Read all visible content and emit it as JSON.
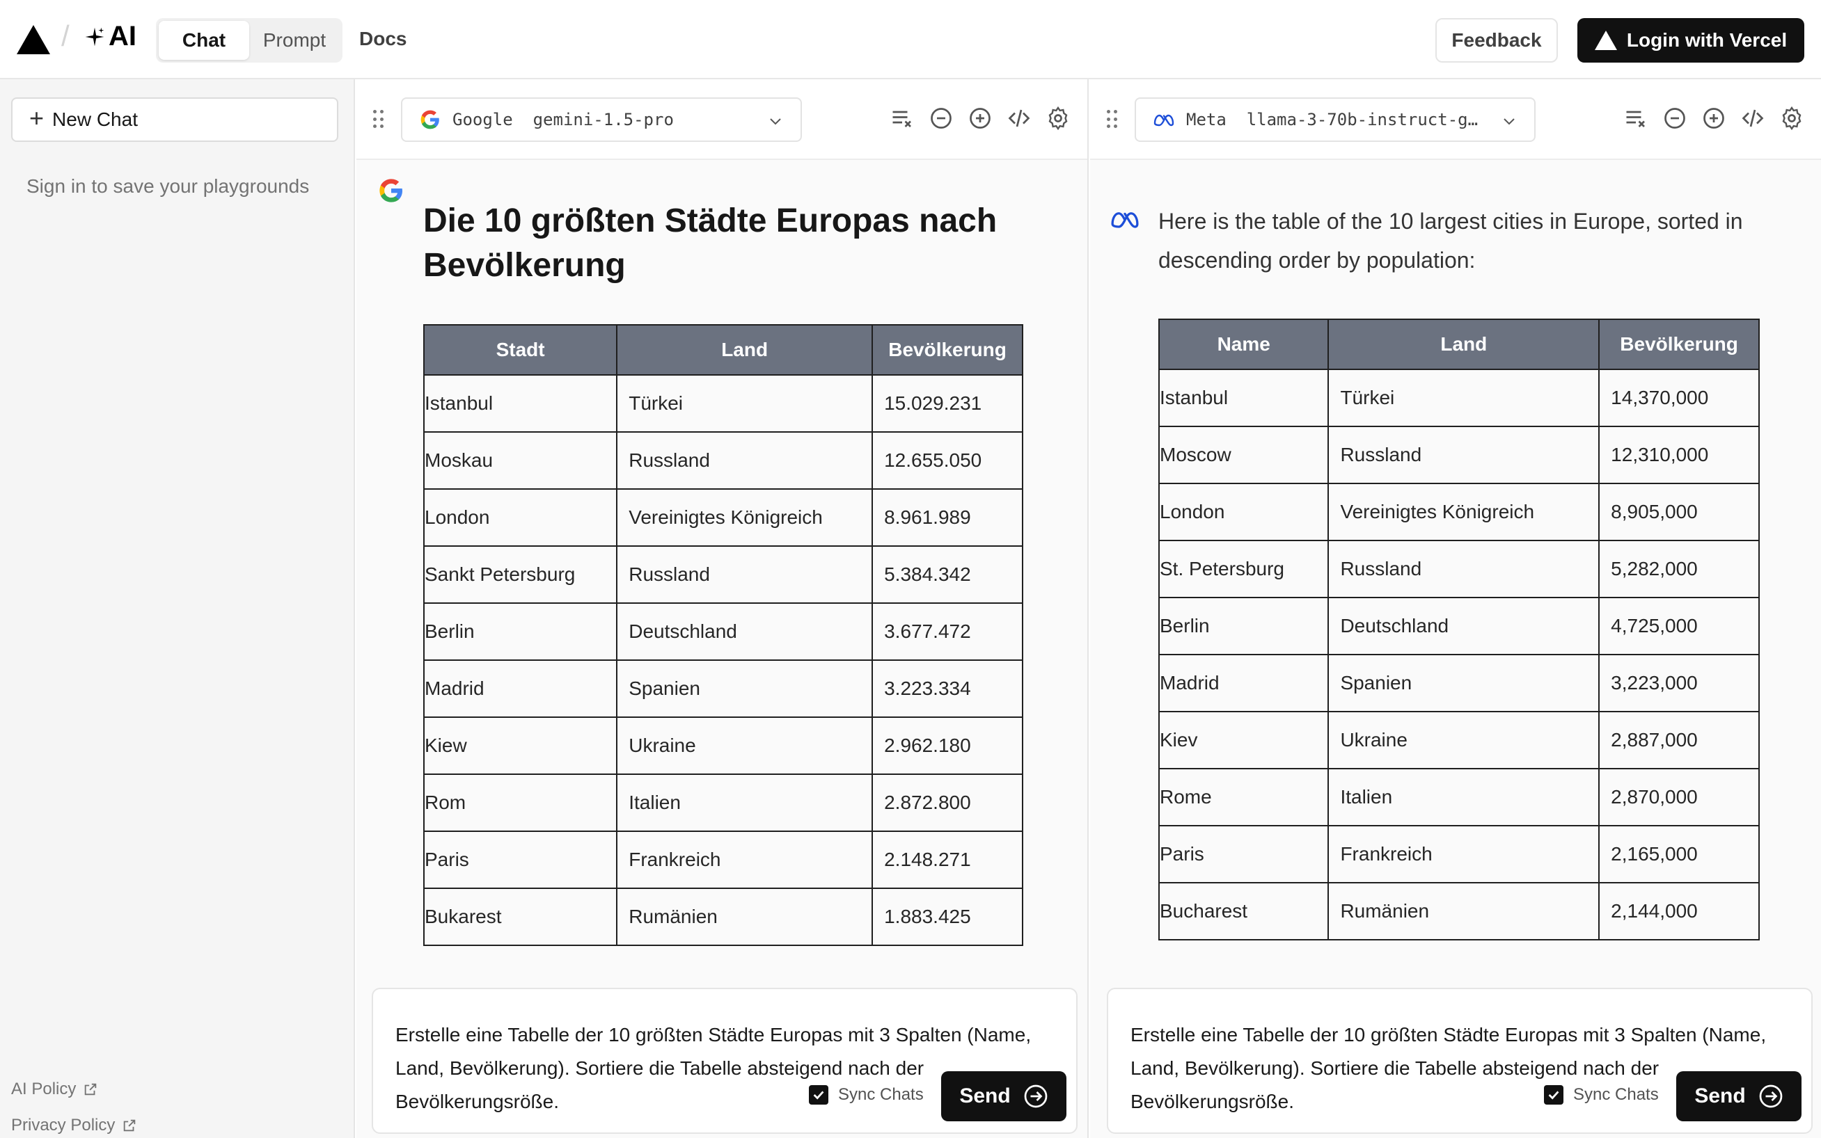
{
  "header": {
    "logo_text": "AI",
    "tabs": [
      {
        "label": "Chat",
        "active": true
      },
      {
        "label": "Prompt",
        "active": false
      }
    ],
    "docs_label": "Docs",
    "feedback_label": "Feedback",
    "login_label": "Login with Vercel"
  },
  "sidebar": {
    "new_chat_label": "New Chat",
    "signin_note": "Sign in to save your playgrounds",
    "footer_links": [
      "AI Policy",
      "Privacy Policy"
    ]
  },
  "colors": {
    "table_header_bg": "#6b7280",
    "button_bg": "#111111",
    "sidebar_bg": "#f5f5f5"
  },
  "panels": [
    {
      "provider": "Google",
      "model": "gemini-1.5-pro",
      "provider_icon": "google-icon",
      "message_heading": "Die 10 größten Städte Europas nach Bevölkerung",
      "table": {
        "headers": [
          "Stadt",
          "Land",
          "Bevölkerung"
        ],
        "rows": [
          [
            "Istanbul",
            "Türkei",
            "15.029.231"
          ],
          [
            "Moskau",
            "Russland",
            "12.655.050"
          ],
          [
            "London",
            "Vereinigtes Königreich",
            "8.961.989"
          ],
          [
            "Sankt Petersburg",
            "Russland",
            "5.384.342"
          ],
          [
            "Berlin",
            "Deutschland",
            "3.677.472"
          ],
          [
            "Madrid",
            "Spanien",
            "3.223.334"
          ],
          [
            "Kiew",
            "Ukraine",
            "2.962.180"
          ],
          [
            "Rom",
            "Italien",
            "2.872.800"
          ],
          [
            "Paris",
            "Frankreich",
            "2.148.271"
          ],
          [
            "Bukarest",
            "Rumänien",
            "1.883.425"
          ]
        ]
      },
      "prompt": "Erstelle eine Tabelle der 10 größten Städte Europas mit 3 Spalten (Name, Land, Bevölkerung). Sortiere die Tabelle absteigend nach der Bevölkerungsröße.",
      "sync_label": "Sync Chats",
      "send_label": "Send"
    },
    {
      "provider": "Meta",
      "model": "llama-3-70b-instruct-g…",
      "provider_icon": "meta-icon",
      "message_text": "Here is the table of the 10 largest cities in Europe, sorted in descending order by population:",
      "table": {
        "headers": [
          "Name",
          "Land",
          "Bevölkerung"
        ],
        "rows": [
          [
            "Istanbul",
            "Türkei",
            "14,370,000"
          ],
          [
            "Moscow",
            "Russland",
            "12,310,000"
          ],
          [
            "London",
            "Vereinigtes Königreich",
            "8,905,000"
          ],
          [
            "St. Petersburg",
            "Russland",
            "5,282,000"
          ],
          [
            "Berlin",
            "Deutschland",
            "4,725,000"
          ],
          [
            "Madrid",
            "Spanien",
            "3,223,000"
          ],
          [
            "Kiev",
            "Ukraine",
            "2,887,000"
          ],
          [
            "Rome",
            "Italien",
            "2,870,000"
          ],
          [
            "Paris",
            "Frankreich",
            "2,165,000"
          ],
          [
            "Bucharest",
            "Rumänien",
            "2,144,000"
          ]
        ]
      },
      "prompt": "Erstelle eine Tabelle der 10 größten Städte Europas mit 3 Spalten (Name, Land, Bevölkerung). Sortiere die Tabelle absteigend nach der Bevölkerungsröße.",
      "sync_label": "Sync Chats",
      "send_label": "Send"
    }
  ]
}
